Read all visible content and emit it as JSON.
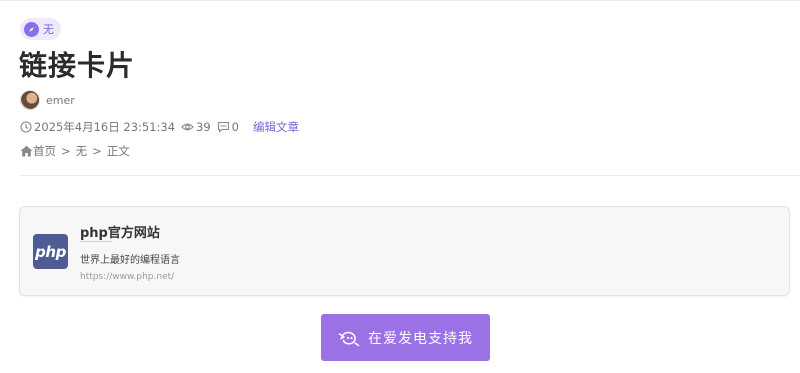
{
  "category": {
    "label": "无"
  },
  "article": {
    "title": "链接卡片"
  },
  "author": {
    "name": "emer"
  },
  "meta": {
    "datetime": "2025年4月16日 23:51:34",
    "views": "39",
    "comments": "0",
    "edit_label": "编辑文章"
  },
  "breadcrumb": {
    "home": "首页",
    "separator": ">",
    "category": "无",
    "current": "正文"
  },
  "link_card": {
    "logo_text": "php",
    "title": "php官方网站",
    "description": "世界上最好的编程语言",
    "url": "https://www.php.net/"
  },
  "support_button": {
    "label": "在爱发电支持我"
  },
  "colors": {
    "accent": "#9b71e6",
    "link": "#7b63d8",
    "php_brand": "#4f5b93"
  }
}
